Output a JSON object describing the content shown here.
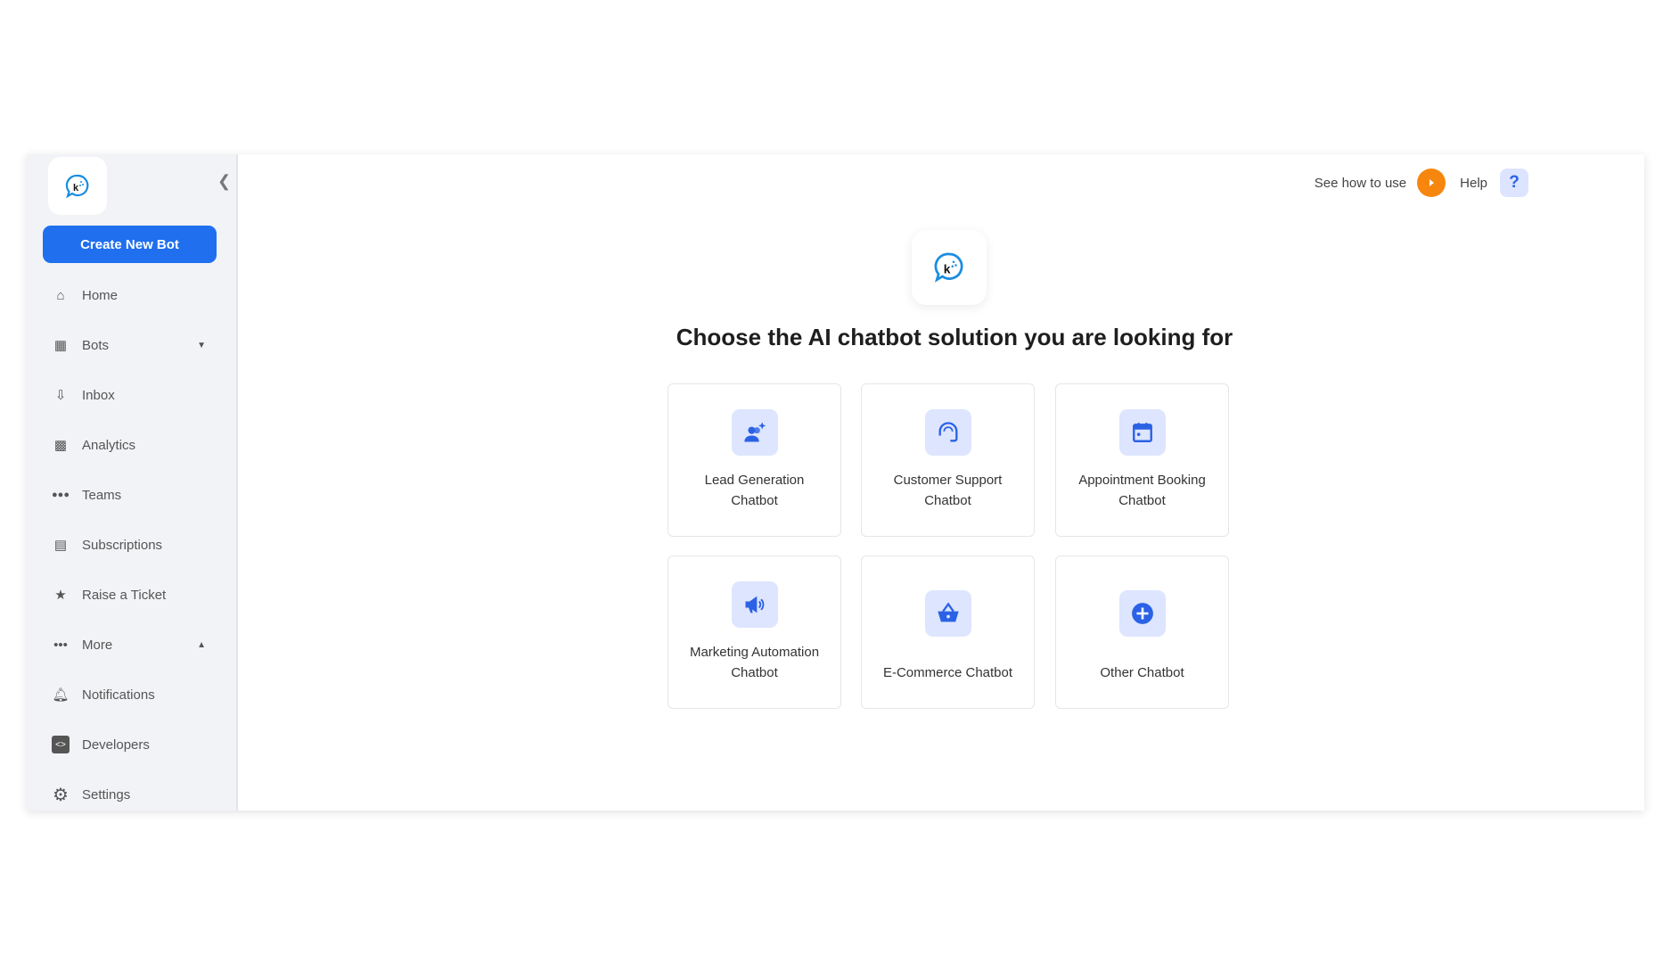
{
  "sidebar": {
    "create_label": "Create New Bot",
    "items": [
      {
        "label": "Home",
        "icon": "home-icon"
      },
      {
        "label": "Bots",
        "icon": "bots-icon"
      },
      {
        "label": "Inbox",
        "icon": "inbox-icon"
      },
      {
        "label": "Analytics",
        "icon": "analytics-icon"
      },
      {
        "label": "Teams",
        "icon": "teams-icon"
      },
      {
        "label": "Subscriptions",
        "icon": "subscriptions-icon"
      },
      {
        "label": "Raise a Ticket",
        "icon": "ticket-icon"
      },
      {
        "label": "More",
        "icon": "more-icon"
      },
      {
        "label": "Notifications",
        "icon": "bell-icon"
      },
      {
        "label": "Developers",
        "icon": "code-icon"
      },
      {
        "label": "Settings",
        "icon": "gear-icon"
      }
    ]
  },
  "header": {
    "see_how": "See how to use",
    "help": "Help",
    "help_glyph": "?"
  },
  "main": {
    "title": "Choose the AI chatbot solution you are looking for",
    "cards": [
      {
        "line1": "Lead Generation",
        "line2": "Chatbot"
      },
      {
        "line1": "Customer Support",
        "line2": "Chatbot"
      },
      {
        "line1": "Appointment Booking",
        "line2": "Chatbot"
      },
      {
        "line1": "Marketing Automation",
        "line2": "Chatbot"
      },
      {
        "line1": "",
        "line2": "E-Commerce Chatbot"
      },
      {
        "line1": "",
        "line2": "Other Chatbot"
      }
    ]
  },
  "colors": {
    "accent": "#1f6fef",
    "orange": "#f7860e",
    "icon_bg": "#dde5ff",
    "sidebar_bg": "#f1f3f6"
  }
}
